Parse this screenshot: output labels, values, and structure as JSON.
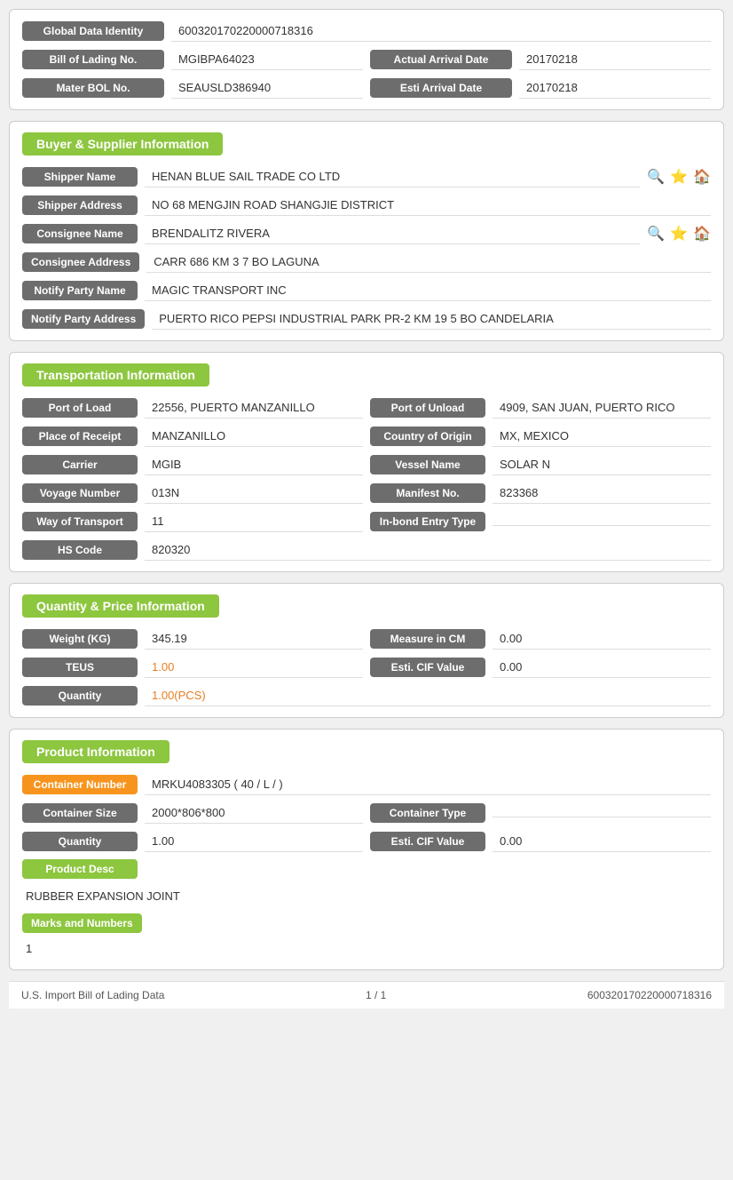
{
  "header": {
    "global_data_identity_label": "Global Data Identity",
    "global_data_identity_value": "600320170220000718316",
    "bill_of_lading_label": "Bill of Lading No.",
    "bill_of_lading_value": "MGIBPA64023",
    "actual_arrival_date_label": "Actual Arrival Date",
    "actual_arrival_date_value": "20170218",
    "mater_bol_label": "Mater BOL No.",
    "mater_bol_value": "SEAUSLD386940",
    "esti_arrival_date_label": "Esti Arrival Date",
    "esti_arrival_date_value": "20170218"
  },
  "buyer_supplier": {
    "section_title": "Buyer & Supplier Information",
    "shipper_name_label": "Shipper Name",
    "shipper_name_value": "HENAN BLUE SAIL TRADE CO LTD",
    "shipper_address_label": "Shipper Address",
    "shipper_address_value": "NO 68 MENGJIN ROAD SHANGJIE DISTRICT",
    "consignee_name_label": "Consignee Name",
    "consignee_name_value": "BRENDALITZ RIVERA",
    "consignee_address_label": "Consignee Address",
    "consignee_address_value": "CARR 686 KM 3 7 BO LAGUNA",
    "notify_party_name_label": "Notify Party Name",
    "notify_party_name_value": "MAGIC TRANSPORT INC",
    "notify_party_address_label": "Notify Party Address",
    "notify_party_address_value": "PUERTO RICO PEPSI INDUSTRIAL PARK PR-2 KM 19 5 BO CANDELARIA"
  },
  "transportation": {
    "section_title": "Transportation Information",
    "port_of_load_label": "Port of Load",
    "port_of_load_value": "22556, PUERTO MANZANILLO",
    "port_of_unload_label": "Port of Unload",
    "port_of_unload_value": "4909, SAN JUAN, PUERTO RICO",
    "place_of_receipt_label": "Place of Receipt",
    "place_of_receipt_value": "MANZANILLO",
    "country_of_origin_label": "Country of Origin",
    "country_of_origin_value": "MX, MEXICO",
    "carrier_label": "Carrier",
    "carrier_value": "MGIB",
    "vessel_name_label": "Vessel Name",
    "vessel_name_value": "SOLAR N",
    "voyage_number_label": "Voyage Number",
    "voyage_number_value": "013N",
    "manifest_no_label": "Manifest No.",
    "manifest_no_value": "823368",
    "way_of_transport_label": "Way of Transport",
    "way_of_transport_value": "11",
    "inbond_entry_type_label": "In-bond Entry Type",
    "inbond_entry_type_value": "",
    "hs_code_label": "HS Code",
    "hs_code_value": "820320"
  },
  "quantity_price": {
    "section_title": "Quantity & Price Information",
    "weight_kg_label": "Weight (KG)",
    "weight_kg_value": "345.19",
    "measure_in_cm_label": "Measure in CM",
    "measure_in_cm_value": "0.00",
    "teus_label": "TEUS",
    "teus_value": "1.00",
    "esti_cif_value_label": "Esti. CIF Value",
    "esti_cif_value_value": "0.00",
    "quantity_label": "Quantity",
    "quantity_value": "1.00(PCS)"
  },
  "product_info": {
    "section_title": "Product Information",
    "container_number_label": "Container Number",
    "container_number_value": "MRKU4083305 ( 40 / L / )",
    "container_size_label": "Container Size",
    "container_size_value": "2000*806*800",
    "container_type_label": "Container Type",
    "container_type_value": "",
    "quantity_label": "Quantity",
    "quantity_value": "1.00",
    "esti_cif_value_label": "Esti. CIF Value",
    "esti_cif_value_value": "0.00",
    "product_desc_label": "Product Desc",
    "product_desc_value": "RUBBER EXPANSION JOINT",
    "marks_and_numbers_label": "Marks and Numbers",
    "marks_and_numbers_value": "1"
  },
  "footer": {
    "left": "U.S. Import Bill of Lading Data",
    "center": "1 / 1",
    "right": "600320170220000718316"
  },
  "icons": {
    "search": "🔍",
    "star": "⭐",
    "home": "🏠"
  }
}
